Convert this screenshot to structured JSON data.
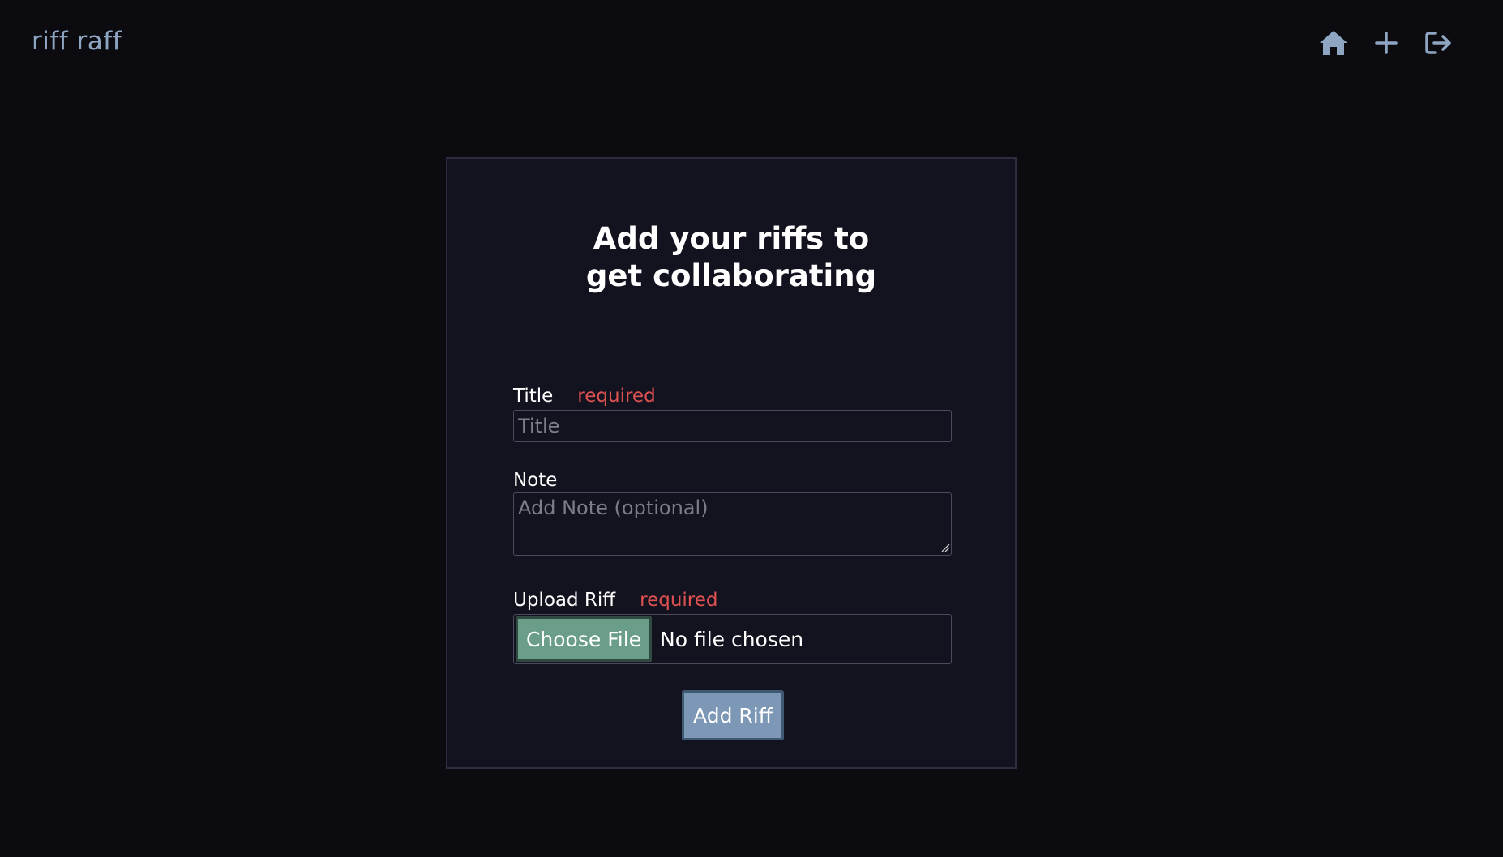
{
  "app": {
    "brand": "riff raff"
  },
  "nav": {
    "icons": [
      "home-icon",
      "plus-icon",
      "sign-out-icon"
    ],
    "icon_color": "#8fa6c3"
  },
  "form": {
    "title": "Add your riffs to get collaborating",
    "title_field": {
      "label": "Title",
      "required_text": "required",
      "placeholder": "Title",
      "value": ""
    },
    "note_field": {
      "label": "Note",
      "placeholder": "Add Note (optional)",
      "value": ""
    },
    "upload_field": {
      "label": "Upload Riff",
      "required_text": "required",
      "button_label": "Choose File",
      "status": "No file chosen"
    },
    "submit_label": "Add Riff"
  },
  "colors": {
    "background": "#0b0b10",
    "card": "#131320",
    "required": "#e05252",
    "choose_button": "#6b9e89",
    "submit_button": "#7c98b6"
  }
}
